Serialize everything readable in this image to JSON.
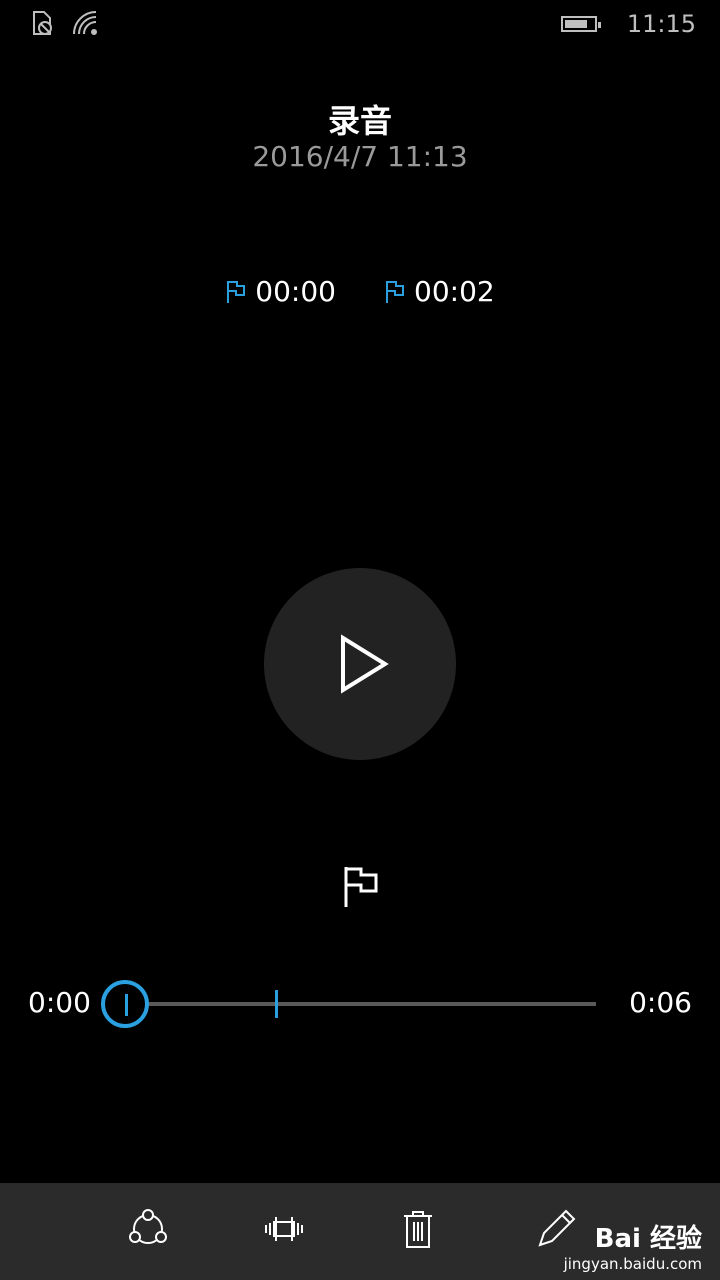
{
  "status": {
    "time": "11:15"
  },
  "header": {
    "title": "录音",
    "datetime": "2016/4/7 11:13"
  },
  "markers": [
    {
      "time": "00:00"
    },
    {
      "time": "00:02"
    }
  ],
  "player": {
    "current": "0:00",
    "total": "0:06"
  },
  "watermark": {
    "brand": "Bai 经验",
    "url": "jingyan.baidu.com"
  },
  "colors": {
    "accent": "#2aa0e0",
    "background": "#000000",
    "appbar": "#2b2b2b"
  }
}
